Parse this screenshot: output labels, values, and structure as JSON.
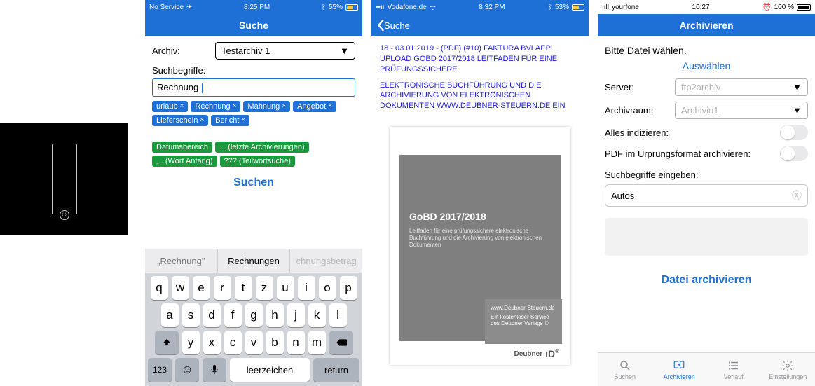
{
  "screen1": {
    "statusbar": {
      "carrier": "No Service",
      "time": "8:25 PM",
      "battery": "55%"
    },
    "title": "Suche",
    "archiveLabel": "Archiv:",
    "archiveValue": "Testarchiv 1",
    "termsLabel": "Suchbegriffe:",
    "termsValue": "Rechnung",
    "blueChips": [
      "urlaub",
      "Rechnung",
      "Mahnung",
      "Angebot",
      "Lieferschein",
      "Bericht"
    ],
    "greenChips": [
      "Datumsbereich",
      "... (letzte Archivierungen)",
      "„.. (Wort Anfang)",
      "??? (Teilwortsuche)"
    ],
    "searchBtn": "Suchen",
    "suggestions": [
      "„Rechnung\"",
      "Rechnungen",
      "chnungsbetrag"
    ],
    "kbRow1": [
      "q",
      "w",
      "e",
      "r",
      "t",
      "z",
      "u",
      "i",
      "o",
      "p"
    ],
    "kbRow2": [
      "a",
      "s",
      "d",
      "f",
      "g",
      "h",
      "j",
      "k",
      "l"
    ],
    "kbRow3": [
      "y",
      "x",
      "c",
      "v",
      "b",
      "n",
      "m"
    ],
    "kbBottom": {
      "num": "123",
      "space": "Leerzeichen",
      "return": "Return"
    }
  },
  "screen2": {
    "statusbar": {
      "carrier": "Vodafone.de",
      "time": "8:32 PM",
      "battery": "53%"
    },
    "back": "Suche",
    "metaLine1": "18 - 03.01.2019 - (PDF) (#10) FAKTURA BVLAPP UPLOAD GOBD 2017/2018 LEITFADEN FÜR EINE PRÜFUNGSSICHERE",
    "metaLine2": "ELEKTRONISCHE BUCHFÜHRUNG UND DIE ARCHIVIERUNG VON ELEKTRONISCHEN DOKUMENTEN WWW.DEUBNER-STEUERN.DE EIN",
    "coverTitle": "GoBD 2017/2018",
    "coverSub": "Leitfaden für eine prüfungssichere elektronische Buchführung und die Archivierung von elektronischen Dokumenten",
    "cardLine1": "www.Deubner-Steuern.de",
    "cardLine2": "Ein kostenloser Service des Deubner Verlags ©",
    "logo": "Deubner"
  },
  "screen3": {
    "statusbar": {
      "carrier": "yourfone",
      "time": "10:27",
      "battery": "100 %"
    },
    "title": "Archivieren",
    "prompt": "Bitte Datei wählen.",
    "pickBtn": "Auswählen",
    "serverLabel": "Server:",
    "serverValue": "ftp2archiv",
    "roomLabel": "Archivraum:",
    "roomValue": "Archivio1",
    "indexAll": "Alles indizieren:",
    "pdfOrig": "PDF im Urprungsformat archivieren:",
    "termsLabel": "Suchbegriffe eingeben:",
    "termsValue": "Autos",
    "archiveBtn": "Datei archivieren",
    "tabs": [
      "Suchen",
      "Archivieren",
      "Verlauf",
      "Einstellungen"
    ]
  }
}
